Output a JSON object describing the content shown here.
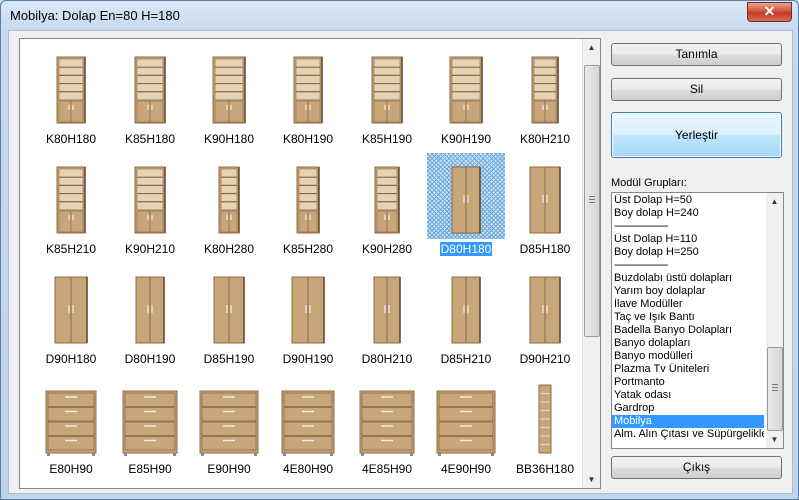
{
  "window": {
    "title": "Mobilya:  Dolap En=80 H=180",
    "close_label": "✕"
  },
  "gallery": {
    "items": [
      {
        "label": "K80H180",
        "type": "bookcase",
        "w": 28,
        "selected": false
      },
      {
        "label": "K85H180",
        "type": "bookcase",
        "w": 30,
        "selected": false
      },
      {
        "label": "K90H180",
        "type": "bookcase",
        "w": 32,
        "selected": false
      },
      {
        "label": "K80H190",
        "type": "bookcase",
        "w": 28,
        "selected": false
      },
      {
        "label": "K85H190",
        "type": "bookcase",
        "w": 30,
        "selected": false
      },
      {
        "label": "K90H190",
        "type": "bookcase",
        "w": 32,
        "selected": false
      },
      {
        "label": "K80H210",
        "type": "bookcase",
        "w": 26,
        "selected": false
      },
      {
        "label": "K85H210",
        "type": "bookcase",
        "w": 28,
        "selected": false
      },
      {
        "label": "K90H210",
        "type": "bookcase",
        "w": 30,
        "selected": false
      },
      {
        "label": "K80H280",
        "type": "bookcase",
        "w": 20,
        "selected": false
      },
      {
        "label": "K85H280",
        "type": "bookcase",
        "w": 22,
        "selected": false
      },
      {
        "label": "K90H280",
        "type": "bookcase",
        "w": 24,
        "selected": false
      },
      {
        "label": "D80H180",
        "type": "door",
        "w": 28,
        "selected": true
      },
      {
        "label": "D85H180",
        "type": "door",
        "w": 30,
        "selected": false
      },
      {
        "label": "D90H180",
        "type": "door",
        "w": 32,
        "selected": false
      },
      {
        "label": "D80H190",
        "type": "door",
        "w": 28,
        "selected": false
      },
      {
        "label": "D85H190",
        "type": "door",
        "w": 30,
        "selected": false
      },
      {
        "label": "D90H190",
        "type": "door",
        "w": 32,
        "selected": false
      },
      {
        "label": "D80H210",
        "type": "door",
        "w": 26,
        "selected": false
      },
      {
        "label": "D85H210",
        "type": "door",
        "w": 28,
        "selected": false
      },
      {
        "label": "D90H210",
        "type": "door",
        "w": 30,
        "selected": false
      },
      {
        "label": "E80H90",
        "type": "drawer",
        "w": 50,
        "selected": false
      },
      {
        "label": "E85H90",
        "type": "drawer",
        "w": 54,
        "selected": false
      },
      {
        "label": "E90H90",
        "type": "drawer",
        "w": 58,
        "selected": false
      },
      {
        "label": "4E80H90",
        "type": "drawer",
        "w": 52,
        "selected": false
      },
      {
        "label": "4E85H90",
        "type": "drawer",
        "w": 54,
        "selected": false
      },
      {
        "label": "4E90H90",
        "type": "drawer",
        "w": 58,
        "selected": false
      },
      {
        "label": "BB36H180",
        "type": "narrow",
        "w": 12,
        "selected": false
      }
    ]
  },
  "buttons": {
    "define": "Tanımla",
    "delete": "Sil",
    "place": "Yerleştir",
    "exit": "Çıkış"
  },
  "groups": {
    "label": "Modül Grupları:",
    "items": [
      {
        "text": "Üst Dolap H=50",
        "selected": false
      },
      {
        "text": "Boy dolap H=240",
        "selected": false
      },
      {
        "text": "--------------------",
        "selected": false
      },
      {
        "text": "Üst Dolap H=110",
        "selected": false
      },
      {
        "text": "Boy dolap H=250",
        "selected": false
      },
      {
        "text": "--------------------",
        "selected": false
      },
      {
        "text": "Buzdolabı üstü dolapları",
        "selected": false
      },
      {
        "text": "Yarım boy dolaplar",
        "selected": false
      },
      {
        "text": "İlave Modüller",
        "selected": false
      },
      {
        "text": "Taç ve Işık Bantı",
        "selected": false
      },
      {
        "text": "Badella Banyo Dolapları",
        "selected": false
      },
      {
        "text": "Banyo dolapları",
        "selected": false
      },
      {
        "text": "Banyo modülleri",
        "selected": false
      },
      {
        "text": "Plazma Tv Üniteleri",
        "selected": false
      },
      {
        "text": "Portmanto",
        "selected": false
      },
      {
        "text": "Yatak odası",
        "selected": false
      },
      {
        "text": "Gardrop",
        "selected": false
      },
      {
        "text": "Mobilya",
        "selected": true
      },
      {
        "text": "Alm. Alın Çıtası ve Süpürgelikler",
        "selected": false
      }
    ]
  },
  "colors": {
    "wood": "#c9a57a",
    "wood_dark": "#8a6a45",
    "shelf": "#e6d2b4",
    "accent_select": "#3399ff"
  }
}
